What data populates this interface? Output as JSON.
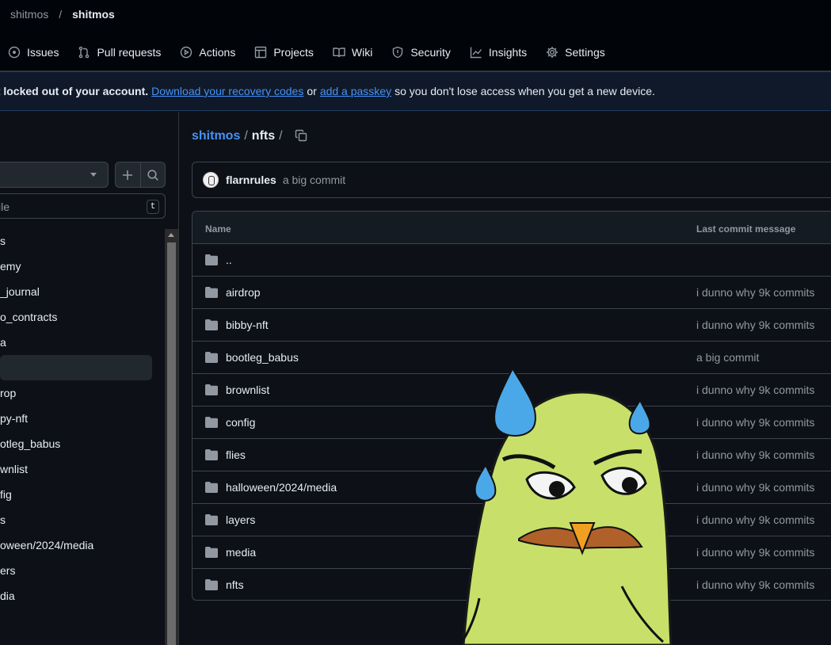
{
  "header": {
    "owner": "shitmos",
    "separator": "/",
    "repo": "shitmos"
  },
  "nav": [
    {
      "label": "Issues",
      "icon": "issue-icon"
    },
    {
      "label": "Pull requests",
      "icon": "pull-request-icon"
    },
    {
      "label": "Actions",
      "icon": "play-icon"
    },
    {
      "label": "Projects",
      "icon": "table-icon"
    },
    {
      "label": "Wiki",
      "icon": "book-icon"
    },
    {
      "label": "Security",
      "icon": "shield-icon"
    },
    {
      "label": "Insights",
      "icon": "graph-icon"
    },
    {
      "label": "Settings",
      "icon": "gear-icon"
    }
  ],
  "banner": {
    "strong": "et locked out of your account.",
    "link1": "Download your recovery codes",
    "mid": "or",
    "link2": "add a passkey",
    "tail": "so you don't lose access when you get a new device."
  },
  "sidebar": {
    "filter_placeholder": "ile",
    "shortcut": "t",
    "items": [
      "s",
      "emy",
      "_journal",
      "o_contracts",
      "a",
      "",
      "rop",
      "py-nft",
      "otleg_babus",
      "wnlist",
      "fig",
      "s",
      "oween/2024/media",
      "ers",
      "dia"
    ]
  },
  "path": {
    "owner": "shitmos",
    "dir": "nfts",
    "sep": "/"
  },
  "commit": {
    "author": "flarnrules",
    "message": "a big commit"
  },
  "table": {
    "col_name": "Name",
    "col_message": "Last commit message",
    "rows": [
      {
        "name": "..",
        "message": ""
      },
      {
        "name": "airdrop",
        "message": "i dunno why 9k commits"
      },
      {
        "name": "bibby-nft",
        "message": "i dunno why 9k commits"
      },
      {
        "name": "bootleg_babus",
        "message": "a big commit"
      },
      {
        "name": "brownlist",
        "message": "i dunno why 9k commits"
      },
      {
        "name": "config",
        "message": "i dunno why 9k commits"
      },
      {
        "name": "flies",
        "message": "i dunno why 9k commits"
      },
      {
        "name": "halloween/2024/media",
        "message": "i dunno why 9k commits"
      },
      {
        "name": "layers",
        "message": "i dunno why 9k commits"
      },
      {
        "name": "media",
        "message": "i dunno why 9k commits"
      },
      {
        "name": "nfts",
        "message": "i dunno why 9k commits"
      }
    ]
  },
  "colors": {
    "background": "#0d1117",
    "link": "#4493f8",
    "sticker_body": "#c8e06a",
    "sweat_drop": "#4aa8e8"
  }
}
